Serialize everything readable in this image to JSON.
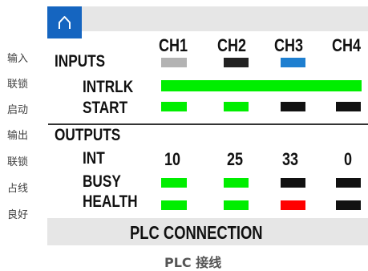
{
  "side_labels": [
    "输入",
    "联锁",
    "启动",
    "输出",
    "联锁",
    "占线",
    "良好"
  ],
  "home_icon": "home-icon",
  "channels": [
    "CH1",
    "CH2",
    "CH3",
    "CH4"
  ],
  "inputs_label": "INPUTS",
  "intrlk_label": "INTRLK",
  "start_label": "START",
  "outputs_label": "OUTPUTS",
  "int_label": "INT",
  "busy_label": "BUSY",
  "health_label": "HEALTH",
  "int_values": [
    "10",
    "25",
    "33",
    "0"
  ],
  "colors": {
    "green": "#00ee00",
    "black": "#111111",
    "red": "#ff0000",
    "blue": "#1e7fd0",
    "gray": "#b3b3b3",
    "dark": "#222222",
    "header_blue": "#1565c0",
    "panel": "#e6e6e6"
  },
  "channel_indicators": [
    "gray",
    "dark",
    "blue",
    "none"
  ],
  "intrlk": "green",
  "start": [
    "green",
    "green",
    "black",
    "black"
  ],
  "busy": [
    "green",
    "green",
    "black",
    "black"
  ],
  "health": [
    "green",
    "green",
    "red",
    "black"
  ],
  "connection_label": "PLC CONNECTION",
  "caption": "PLC 接线"
}
